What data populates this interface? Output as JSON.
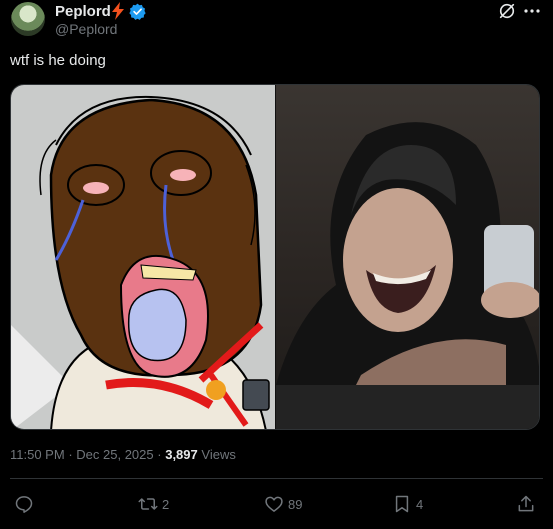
{
  "author": {
    "name": "Peplord",
    "handle": "@Peplord"
  },
  "post": {
    "text": "wtf is he doing",
    "time": "11:50 PM",
    "date": "Dec 25, 2025",
    "separator": "·",
    "views_count": "3,897",
    "views_label": "Views"
  },
  "actions": {
    "reply_count": "",
    "repost_count": "2",
    "like_count": "89",
    "bookmark_count": "4"
  },
  "icons": [
    "avatar",
    "bolt-icon",
    "verified-icon",
    "grok-icon",
    "more-icon",
    "reply-icon",
    "repost-icon",
    "like-icon",
    "bookmark-icon",
    "share-icon"
  ],
  "colors": {
    "background": "#000000",
    "text": "#e7e9ea",
    "muted": "#71767b",
    "verified": "#1d9bf0",
    "bolt": "#f4511e"
  }
}
